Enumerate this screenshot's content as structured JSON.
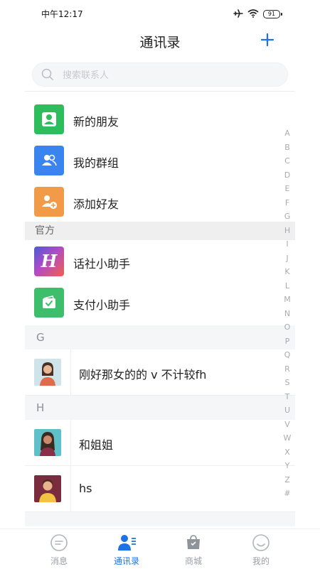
{
  "status_bar": {
    "time": "中午12:17",
    "battery": "91"
  },
  "header": {
    "title": "通讯录",
    "add_icon": "plus-icon"
  },
  "search": {
    "placeholder": "搜索联系人"
  },
  "quick_items": [
    {
      "label": "新的朋友",
      "icon": "user-icon",
      "color": "#2ebd5c"
    },
    {
      "label": "我的群组",
      "icon": "group-icon",
      "color": "#3a84f0"
    },
    {
      "label": "添加好友",
      "icon": "add-user-icon",
      "color": "#f19b48"
    }
  ],
  "official_section": {
    "title": "官方",
    "items": [
      {
        "label": "话社小助手",
        "icon": "h-logo-icon"
      },
      {
        "label": "支付小助手",
        "icon": "wallet-icon",
        "color": "#3dbe6a"
      }
    ]
  },
  "groups": [
    {
      "letter": "G",
      "contacts": [
        {
          "name": "刚好那女的的 v 不计较fh"
        }
      ]
    },
    {
      "letter": "H",
      "contacts": [
        {
          "name": "和姐姐"
        },
        {
          "name": "hs"
        }
      ]
    }
  ],
  "index_letters": [
    "A",
    "B",
    "C",
    "D",
    "E",
    "F",
    "G",
    "H",
    "I",
    "J",
    "K",
    "L",
    "M",
    "N",
    "O",
    "P",
    "Q",
    "R",
    "S",
    "T",
    "U",
    "V",
    "W",
    "X",
    "Y",
    "Z",
    "#"
  ],
  "tabs": [
    {
      "label": "消息",
      "icon": "message-icon",
      "active": false
    },
    {
      "label": "通讯录",
      "icon": "contacts-icon",
      "active": true
    },
    {
      "label": "商城",
      "icon": "shopping-bag-icon",
      "active": false
    },
    {
      "label": "我的",
      "icon": "smiley-icon",
      "active": false
    }
  ],
  "colors": {
    "accent": "#1a73e8",
    "inactive": "#9aa0a8"
  }
}
